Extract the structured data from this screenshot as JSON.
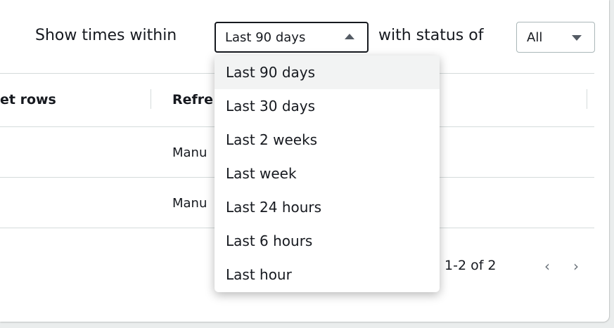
{
  "filters": {
    "times_label": "Show times within",
    "times_value": "Last 90 days",
    "status_label": "with status of",
    "status_value": "All"
  },
  "table": {
    "headers": [
      "et rows",
      "Refre"
    ],
    "rows": [
      {
        "refresh": "Manu"
      },
      {
        "refresh": "Manu"
      }
    ]
  },
  "pagination": {
    "count": "1-2 of 2",
    "prev_glyph": "‹",
    "next_glyph": "›"
  },
  "dropdown": {
    "options": [
      "Last 90 days",
      "Last 30 days",
      "Last 2 weeks",
      "Last week",
      "Last 24 hours",
      "Last 6 hours",
      "Last hour"
    ],
    "selected": "Last 90 days"
  }
}
